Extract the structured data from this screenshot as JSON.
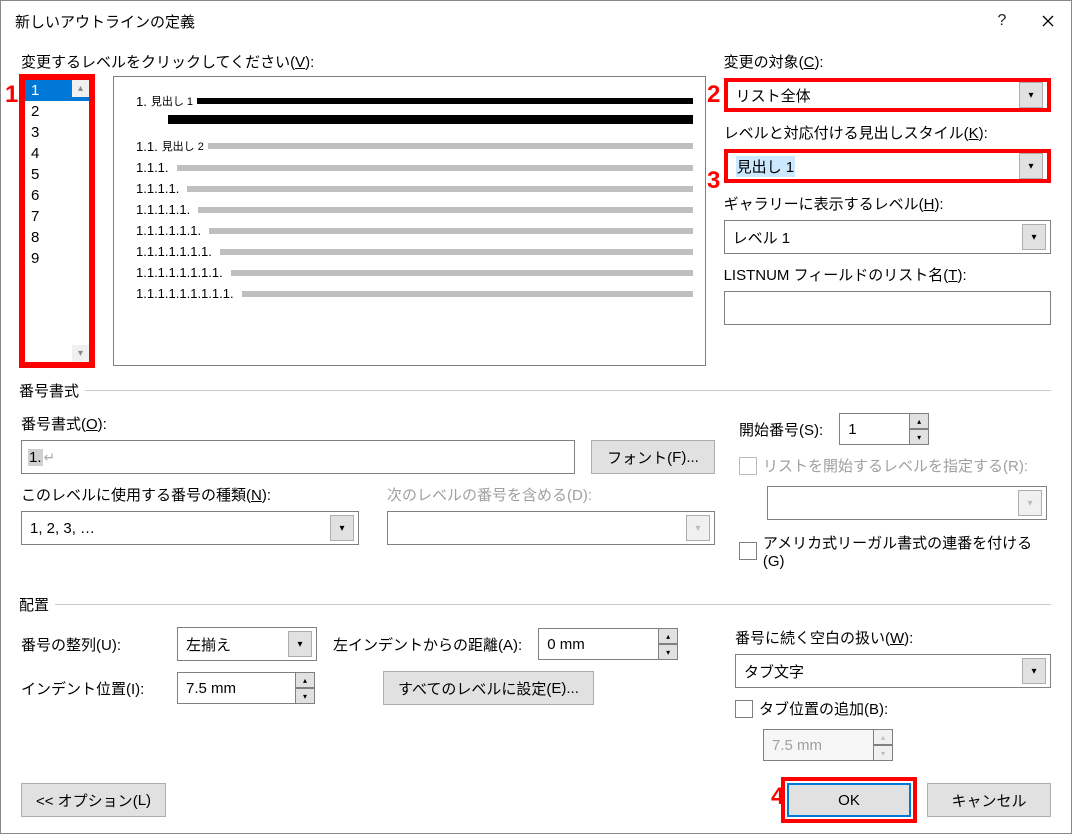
{
  "window": {
    "title": "新しいアウトラインの定義"
  },
  "annotations": {
    "a1": "1",
    "a2": "2",
    "a3": "3",
    "a4": "4"
  },
  "level_click_label_pre": "変更するレベルをクリックしてください(",
  "level_click_label_key": "V",
  "level_click_label_post": "):",
  "levels": [
    "1",
    "2",
    "3",
    "4",
    "5",
    "6",
    "7",
    "8",
    "9"
  ],
  "preview": {
    "l1_num": "1.",
    "l1_head": "見出し 1",
    "l2_num": "1.1.",
    "l2_head": "見出し 2",
    "l3": "1.1.1.",
    "l4": "1.1.1.1.",
    "l5": "1.1.1.1.1.",
    "l6": "1.1.1.1.1.1.",
    "l7": "1.1.1.1.1.1.1.",
    "l8": "1.1.1.1.1.1.1.1.",
    "l9": "1.1.1.1.1.1.1.1.1."
  },
  "right": {
    "apply_to_label_pre": "変更の対象(",
    "apply_to_key": "C",
    "apply_to_post": "):",
    "apply_to_value": "リスト全体",
    "link_style_label_pre": "レベルと対応付ける見出しスタイル(",
    "link_style_key": "K",
    "link_style_post": "):",
    "link_style_value": "見出し 1",
    "gallery_label_pre": "ギャラリーに表示するレベル(",
    "gallery_key": "H",
    "gallery_post": "):",
    "gallery_value": "レベル 1",
    "listnum_label_pre": "LISTNUM フィールドのリスト名(",
    "listnum_key": "T",
    "listnum_post": "):",
    "listnum_value": ""
  },
  "number_format": {
    "legend": "番号書式",
    "format_label_pre": "番号書式(",
    "format_key": "O",
    "format_post": "):",
    "format_value": "1.",
    "font_btn_pre": "フォント(",
    "font_key": "F",
    "font_post": ")...",
    "style_label_pre": "このレベルに使用する番号の種類(",
    "style_key": "N",
    "style_post": "):",
    "style_value": "1, 2, 3, …",
    "include_label_pre": "次のレベルの番号を含める(",
    "include_key": "D",
    "include_post": "):",
    "include_value": "",
    "start_label_pre": "開始番号(",
    "start_key": "S",
    "start_post": "):",
    "start_value": "1",
    "restart_label_pre": "リストを開始するレベルを指定する(",
    "restart_key": "R",
    "restart_post": "):",
    "restart_value": "",
    "legal_label_pre": "アメリカ式リーガル書式の連番を付ける(",
    "legal_key": "G",
    "legal_post": ")"
  },
  "position": {
    "legend": "配置",
    "align_label_pre": "番号の整列(",
    "align_key": "U",
    "align_post": "):",
    "align_value": "左揃え",
    "aligned_at_label_pre": "左インデントからの距離(",
    "aligned_at_key": "A",
    "aligned_at_post": "):",
    "aligned_at_value": "0 mm",
    "indent_label_pre": "インデント位置(",
    "indent_key": "I",
    "indent_post": "):",
    "indent_value": "7.5 mm",
    "set_all_pre": "すべてのレベルに設定(",
    "set_all_key": "E",
    "set_all_post": ")...",
    "follow_label_pre": "番号に続く空白の扱い(",
    "follow_key": "W",
    "follow_post": "):",
    "follow_value": "タブ文字",
    "tab_label_pre": "タブ位置の追加(",
    "tab_key": "B",
    "tab_post": "):",
    "tab_value": "7.5 mm"
  },
  "buttons": {
    "options_pre": "<< オプション(",
    "options_key": "L",
    "options_post": ")",
    "ok": "OK",
    "cancel": "キャンセル"
  }
}
